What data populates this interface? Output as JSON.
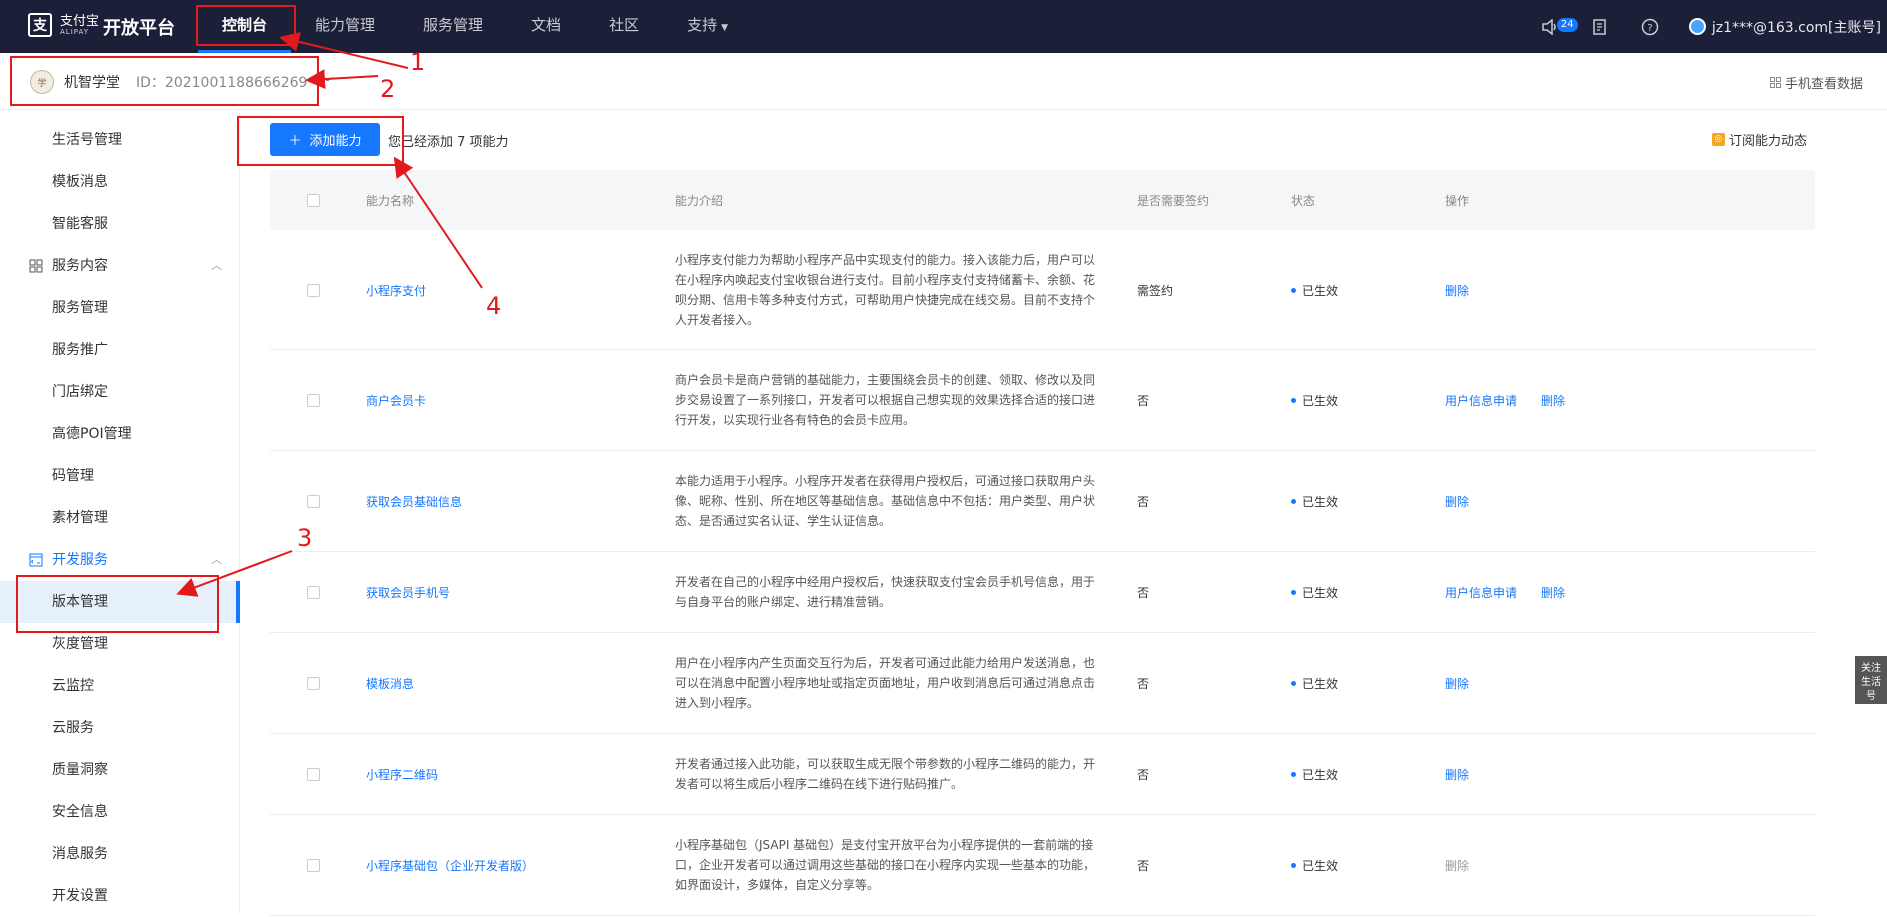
{
  "topbar": {
    "logo_text": "支付宝",
    "logo_sub": "ALIPAY",
    "platform": "开放平台",
    "nav": [
      "控制台",
      "能力管理",
      "服务管理",
      "文档",
      "社区",
      "支持"
    ],
    "badge_count": "24",
    "account": "jz1***@163.com[主账号]"
  },
  "subheader": {
    "app_name": "机智学堂",
    "app_id": "ID：2021001188666269",
    "mobile_data": "手机查看数据"
  },
  "sidebar": {
    "items_top": [
      "生活号管理",
      "模板消息",
      "智能客服"
    ],
    "group_service": "服务内容",
    "items_service": [
      "服务管理",
      "服务推广",
      "门店绑定",
      "高德POI管理",
      "码管理",
      "素材管理"
    ],
    "group_dev": "开发服务",
    "items_dev": [
      "版本管理",
      "灰度管理",
      "云监控",
      "云服务",
      "质量洞察",
      "安全信息",
      "消息服务",
      "开发设置"
    ]
  },
  "main": {
    "add_button": "添加能力",
    "added_text": "您已经添加 7 项能力",
    "subscribe": "订阅能力动态",
    "columns": [
      "能力名称",
      "能力介绍",
      "是否需要签约",
      "状态",
      "操作"
    ],
    "rows": [
      {
        "name": "小程序支付",
        "desc": "小程序支付能力为帮助小程序产品中实现支付的能力。接入该能力后，用户可以在小程序内唤起支付宝收银台进行支付。目前小程序支付支持储蓄卡、余额、花呗分期、信用卡等多种支付方式，可帮助用户快捷完成在线交易。目前不支持个人开发者接入。",
        "sign": "需签约",
        "status": "已生效",
        "ops": [
          "删除"
        ]
      },
      {
        "name": "商户会员卡",
        "desc": "商户会员卡是商户营销的基础能力，主要围绕会员卡的创建、领取、修改以及同步交易设置了一系列接口，开发者可以根据自己想实现的效果选择合适的接口进行开发，以实现行业各有特色的会员卡应用。",
        "sign": "否",
        "status": "已生效",
        "ops": [
          "用户信息申请",
          "删除"
        ]
      },
      {
        "name": "获取会员基础信息",
        "desc": "本能力适用于小程序。小程序开发者在获得用户授权后，可通过接口获取用户头像、昵称、性别、所在地区等基础信息。基础信息中不包括：用户类型、用户状态、是否通过实名认证、学生认证信息。",
        "sign": "否",
        "status": "已生效",
        "ops": [
          "删除"
        ]
      },
      {
        "name": "获取会员手机号",
        "desc": "开发者在自己的小程序中经用户授权后，快速获取支付宝会员手机号信息，用于与自身平台的账户绑定、进行精准营销。",
        "sign": "否",
        "status": "已生效",
        "ops": [
          "用户信息申请",
          "删除"
        ]
      },
      {
        "name": "模板消息",
        "desc": "用户在小程序内产生页面交互行为后，开发者可通过此能力给用户发送消息，也可以在消息中配置小程序地址或指定页面地址，用户收到消息后可通过消息点击进入到小程序。",
        "sign": "否",
        "status": "已生效",
        "ops": [
          "删除"
        ]
      },
      {
        "name": "小程序二维码",
        "desc": "开发者通过接入此功能，可以获取生成无限个带参数的小程序二维码的能力，开发者可以将生成后小程序二维码在线下进行贴码推广。",
        "sign": "否",
        "status": "已生效",
        "ops": [
          "删除"
        ]
      },
      {
        "name": "小程序基础包（企业开发者版）",
        "desc": "小程序基础包（JSAPI 基础包）是支付宝开放平台为小程序提供的一套前端的接口，企业开发者可以通过调用这些基础的接口在小程序内实现一些基本的功能，如界面设计，多媒体，自定义分享等。",
        "sign": "否",
        "status": "已生效",
        "ops": [
          "删除"
        ]
      }
    ]
  },
  "float_tab": "关注生活号",
  "annotations": [
    "1",
    "2",
    "3",
    "4"
  ],
  "colors": {
    "topbar": "#1b1f37",
    "accent": "#1677ff",
    "annotation": "#e3191c"
  }
}
